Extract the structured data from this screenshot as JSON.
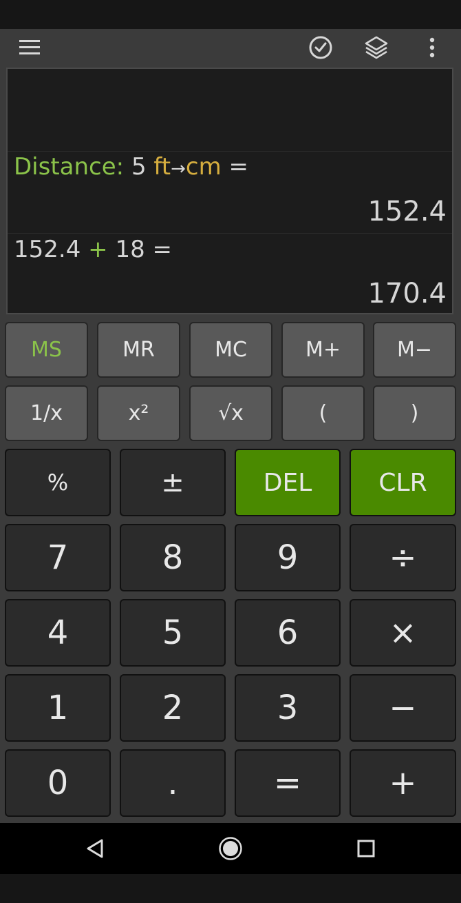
{
  "display": {
    "history": [
      {
        "label": "Distance:",
        "value": "5",
        "unit_from": "ft",
        "arrow": "→",
        "unit_to": "cm",
        "equals": "=",
        "result": "152.4"
      },
      {
        "operand1": "152.4",
        "operator": "+",
        "operand2": "18",
        "equals": "=",
        "result": "170.4"
      }
    ]
  },
  "memory_row": [
    "MS",
    "MR",
    "MC",
    "M+",
    "M−"
  ],
  "function_row": [
    "1/x",
    "x²",
    "√x",
    "(",
    ")"
  ],
  "keypad": {
    "row1": [
      "%",
      "±",
      "DEL",
      "CLR"
    ],
    "row2": [
      "7",
      "8",
      "9",
      "÷"
    ],
    "row3": [
      "4",
      "5",
      "6",
      "×"
    ],
    "row4": [
      "1",
      "2",
      "3",
      "−"
    ],
    "row5": [
      "0",
      ".",
      "=",
      "+"
    ]
  },
  "colors": {
    "accent_green": "#8bc34a",
    "unit_yellow": "#d6ae3f",
    "button_green": "#4a8a00"
  },
  "icons": {
    "toolbar": [
      "menu-icon",
      "history-clock-icon",
      "layers-icon",
      "more-vert-icon"
    ],
    "nav": [
      "back-icon",
      "home-icon",
      "recents-icon"
    ]
  }
}
